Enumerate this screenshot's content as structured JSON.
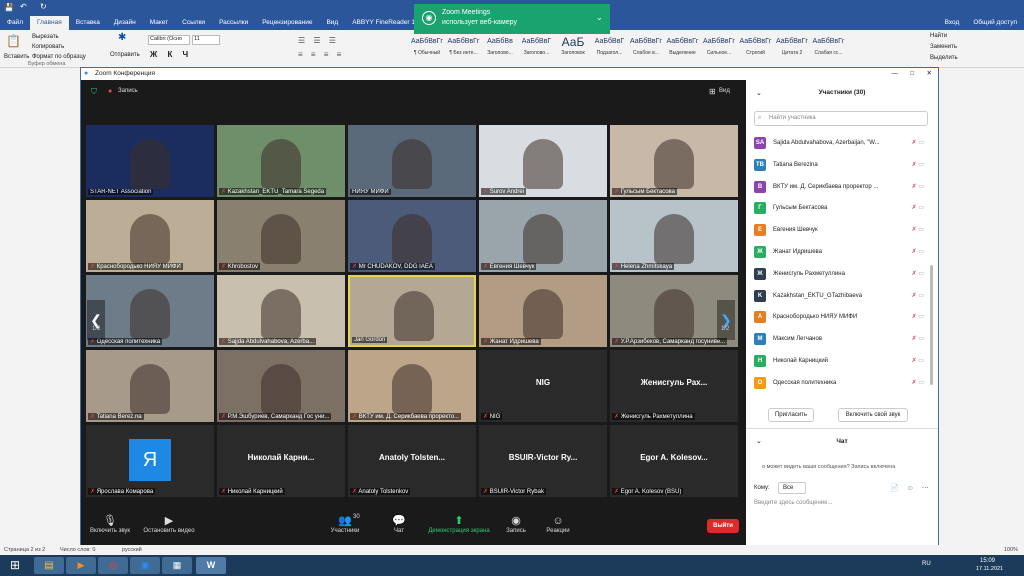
{
  "word": {
    "tabs": [
      "Файл",
      "Главная",
      "Вставка",
      "Дизайн",
      "Макет",
      "Ссылки",
      "Рассылки",
      "Рецензирование",
      "Вид",
      "ABBYY FineReader 12"
    ],
    "tabs_right": [
      "Вход",
      "Общий доступ"
    ],
    "clipboard": {
      "paste": "Вставить",
      "cut": "Вырезать",
      "copy": "Копировать",
      "format": "Формат по образцу",
      "group": "Буфер обмена",
      "send": "Отправить"
    },
    "font_name": "Calibri (Осно",
    "font_size": "11",
    "styles": [
      {
        "preview": "АаБбВвГг",
        "name": "¶ Обычный"
      },
      {
        "preview": "АаБбВвГг",
        "name": "¶ Без инте..."
      },
      {
        "preview": "АаБбВв",
        "name": "Заголово..."
      },
      {
        "preview": "АаБбВвГ",
        "name": "Заголово..."
      },
      {
        "preview": "АаБ",
        "name": "Заголовок"
      },
      {
        "preview": "АаБбВвГ",
        "name": "Подзагол..."
      },
      {
        "preview": "АаБбВвГг",
        "name": "Слабое в..."
      },
      {
        "preview": "АаБбВвГг",
        "name": "Выделение"
      },
      {
        "preview": "АаБбВвГг",
        "name": "Сильное..."
      },
      {
        "preview": "АаБбВвГг",
        "name": "Строгий"
      },
      {
        "preview": "АаБбВвГг",
        "name": "Цитата 2"
      },
      {
        "preview": "АаБбВвГг",
        "name": "Слабая сс..."
      }
    ],
    "editing": [
      "Найти",
      "Заменить",
      "Выделить"
    ],
    "status": {
      "page": "Страница 2 из 2",
      "words": "Число слов: 0",
      "lang": "русский",
      "zoom": "100%"
    }
  },
  "toast": {
    "title": "Zoom Meetings",
    "text": "использует веб-камеру"
  },
  "zoom": {
    "title": "Zoom Конференция",
    "rec": "Запись",
    "view": "Вид",
    "page_left": "1/2",
    "page_right": "1/2",
    "tiles": [
      "STAR-NET Association",
      "Kazakhstan_EKTU_Tamara Segeda",
      "НИЯУ МИФИ",
      "Surov Andrei",
      "Гульсым Бектасова",
      "Краснобородько НИЯУ МИФИ",
      "Khrobostov",
      "Mr CHUDAKOV, DDG IAEA",
      "Евгения Шевчук",
      "Helena Zhmitskaya",
      "Одесская политехника",
      "Sajjda Abdulvahabova, Azerba...",
      "Jan Gordon",
      "Жанат Идришева",
      "У.Р.Арзибеков, Самарканд госуниве...",
      "Tatiana Berez.na",
      "Р.М.Эшбуриев, Самарканд Гос уни...",
      "ВКТУ им. Д. Серикбаева проректо...",
      "NIG",
      "Женисгуль Рахметуллина",
      "Ярославa Комарова",
      "Николай Карницкий",
      "Anatoly Tolstenkov",
      "BSUIR-Victor Rybak",
      "Egor A. Kolesov (BSU)"
    ],
    "big_names": {
      "nig": "NIG",
      "zhen": "Женисгуль Рах...",
      "nik": "Николай Карни...",
      "anat": "Anatoly Tolsten...",
      "bsuir": "BSUIR-Victor Ry...",
      "egor": "Egor A. Kolesov..."
    },
    "ya_letter": "Я",
    "controls": [
      "Включить звук",
      "Остановить видео",
      "Участники",
      "Чат",
      "Демонстрация экрана",
      "Запись",
      "Реакции",
      "Выйти"
    ],
    "participants_count": "30",
    "panel": {
      "title": "Участники (30)",
      "search": "Найти участника",
      "list": [
        {
          "i": "SA",
          "n": "Sajida Abdulvahabova, Azerbaijan, \"W...",
          "c": "#8e44ad"
        },
        {
          "i": "TB",
          "n": "Tatiana Berezina",
          "c": "#2c7fb8"
        },
        {
          "i": "В",
          "n": "ВКТУ им. Д. Серикбаева проректор ...",
          "c": "#8e44ad"
        },
        {
          "i": "Г",
          "n": "Гульсым Бектасова",
          "c": "#27ae60"
        },
        {
          "i": "Е",
          "n": "Евгения Шевчук",
          "c": "#e67e22"
        },
        {
          "i": "Ж",
          "n": "Жанат Идришева",
          "c": "#27ae60"
        },
        {
          "i": "Ж",
          "n": "Женисгуль Рахметуллина",
          "c": "#2c3e50"
        },
        {
          "i": "K",
          "n": "Kazakhstan_EKTU_GTazhibaeva",
          "c": "#2c3e50"
        },
        {
          "i": "А",
          "n": "Красноборoдько НИЯУ МИФИ",
          "c": "#e67e22"
        },
        {
          "i": "М",
          "n": "Максим Легчанов",
          "c": "#2c7fb8"
        },
        {
          "i": "Н",
          "n": "Николай Карницкий",
          "c": "#27ae60"
        },
        {
          "i": "О",
          "n": "Одесская политехника",
          "c": "#f39c12"
        }
      ],
      "invite": "Пригласить",
      "unmute": "Включить свой звук",
      "chat_title": "Чат",
      "chat_note": "о может видеть ваши сообщения? Запись включена",
      "to_label": "Кому:",
      "to_value": "Все",
      "input_ph": "Введите здесь сообщение..."
    }
  },
  "clock": {
    "time": "15:09",
    "date": "17.11.2021",
    "lang": "RU"
  }
}
